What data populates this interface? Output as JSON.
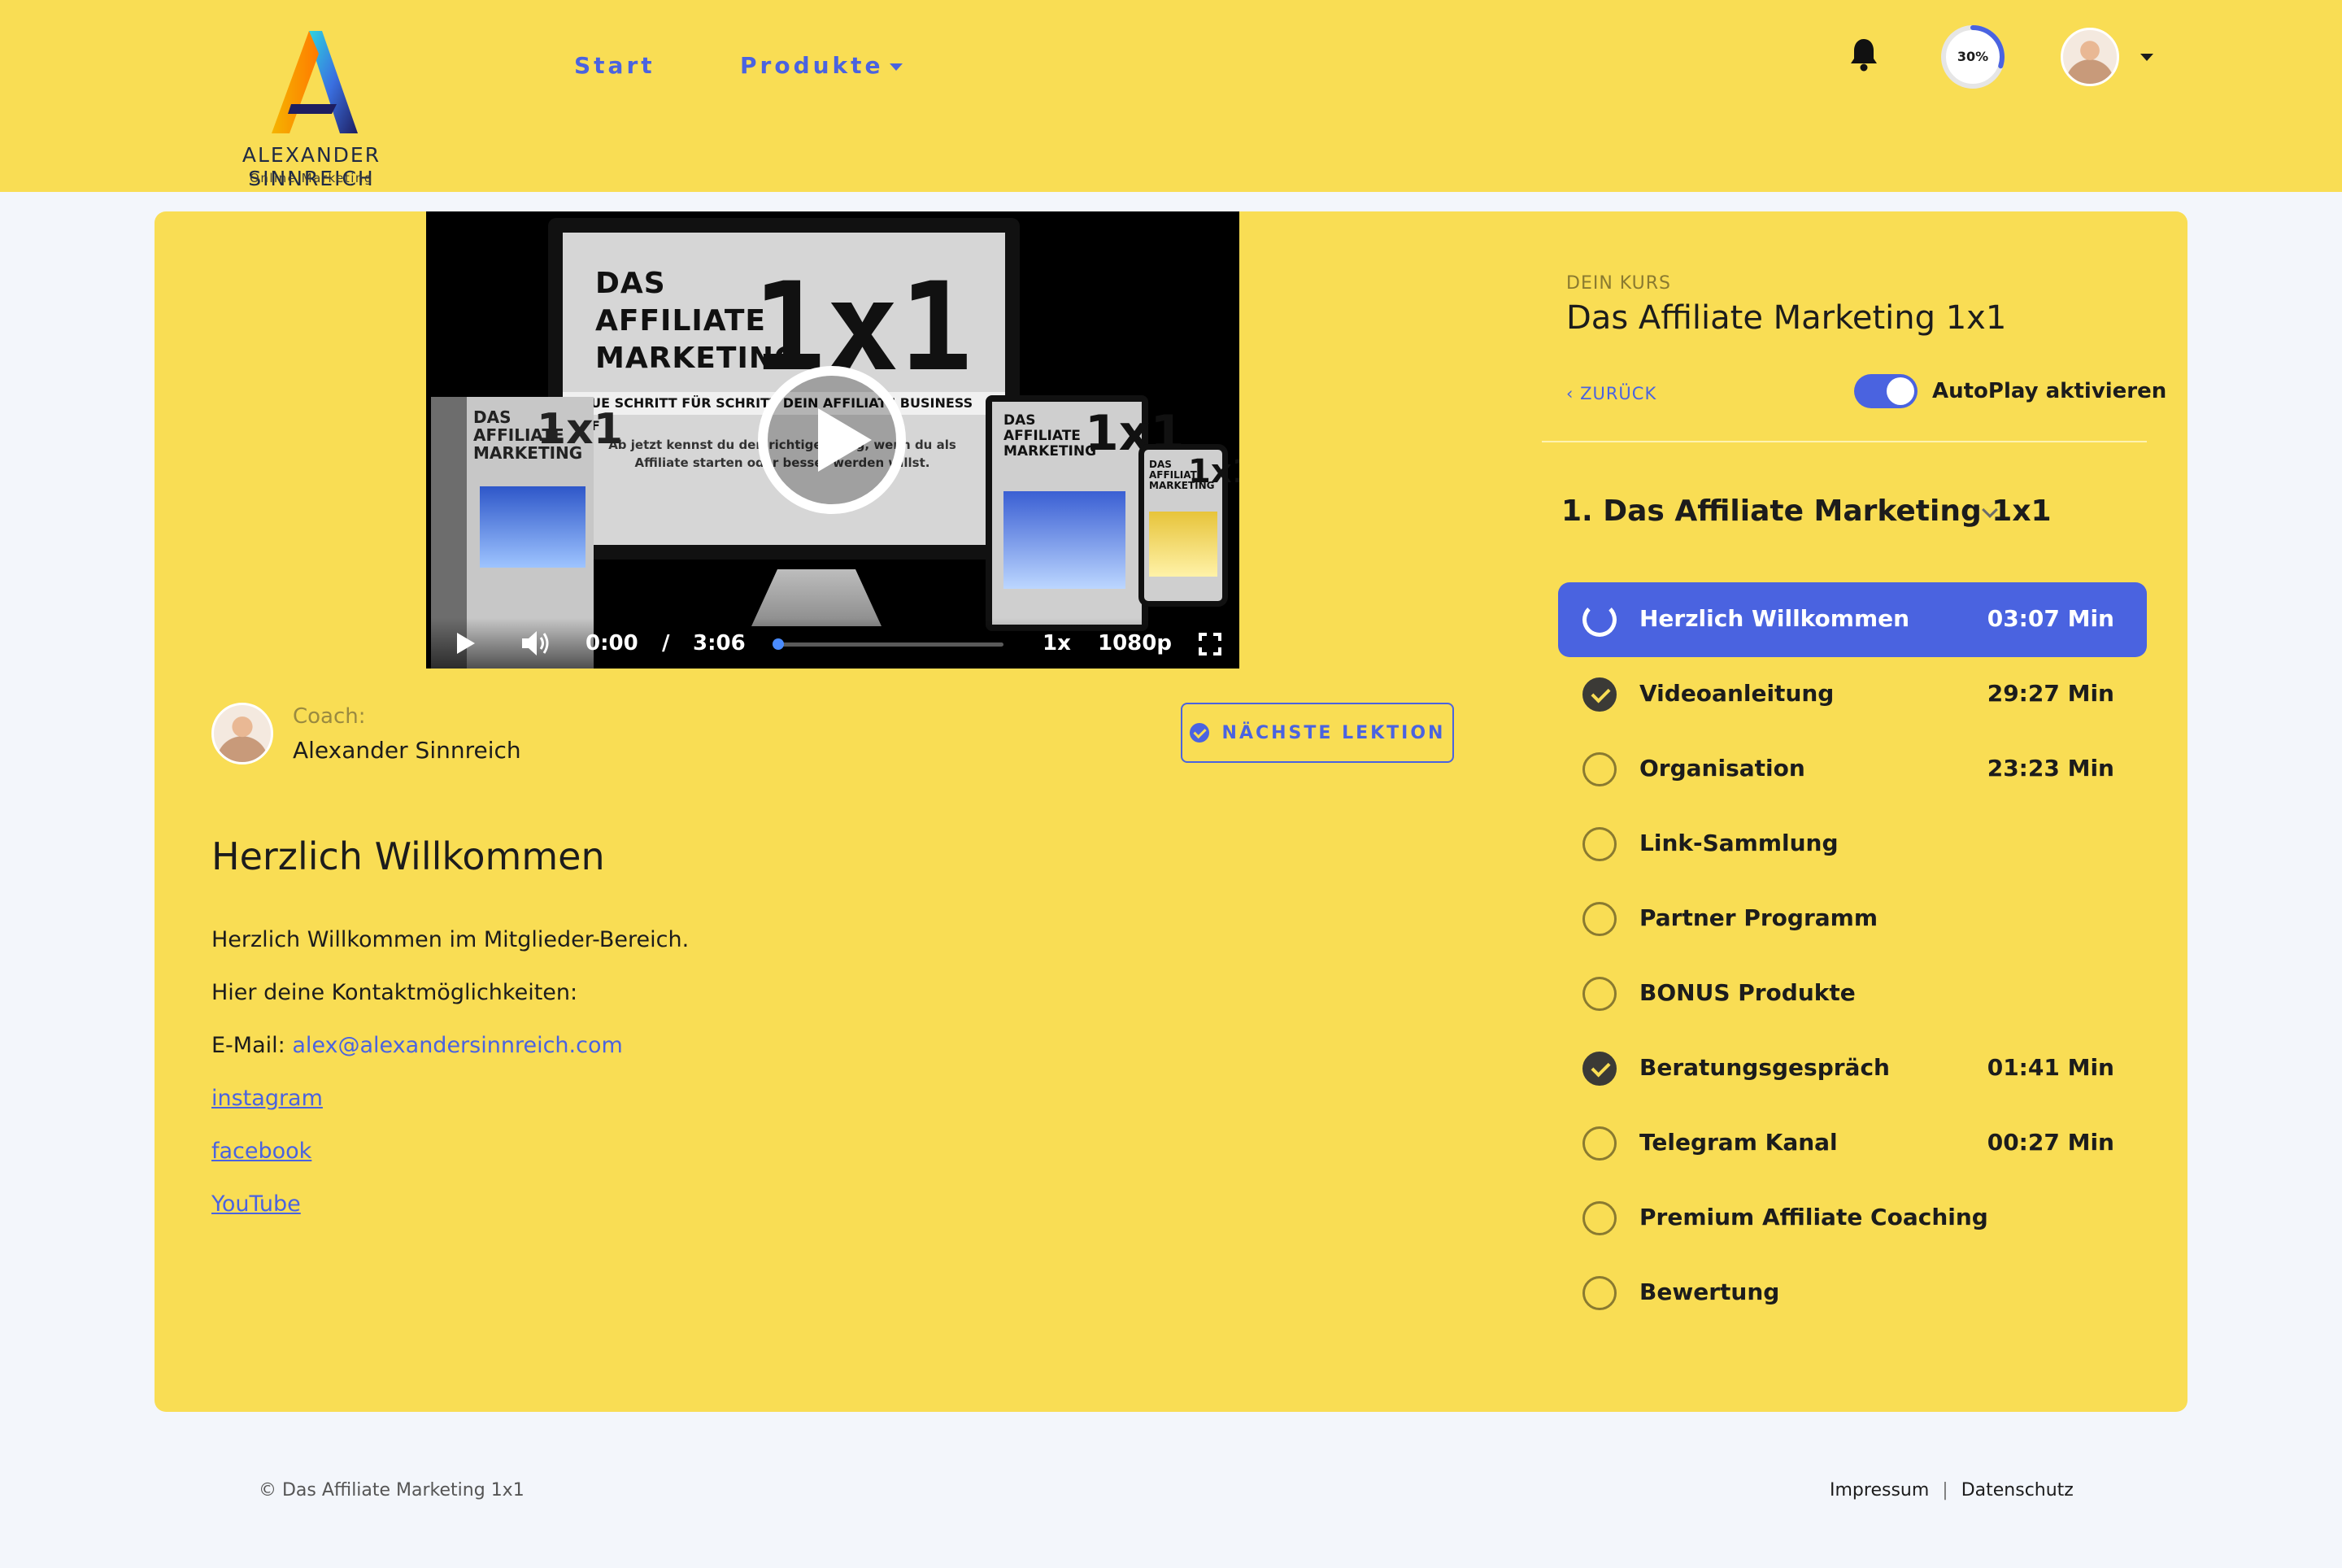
{
  "brand": {
    "logo_letter": "A",
    "name": "ALEXANDER SINNREICH",
    "tagline": "Online Marketing"
  },
  "nav": {
    "items": [
      {
        "label": "Start"
      },
      {
        "label": "Produkte"
      }
    ]
  },
  "header": {
    "progress_text": "30%",
    "progress_value": 0.3
  },
  "video": {
    "monitor_title": "DAS AFFILIATE MARKETING",
    "monitor_big": "1x1",
    "monitor_strip": "BAUE SCHRITT FÜR SCHRITT DEIN AFFILIATE BUSINESS AUF",
    "monitor_text": "Ab jetzt kennst du den richtigen Weg, wenn du als Affiliate starten oder besser werden willst.",
    "box_title": "DAS AFFILIATE MARKETING",
    "box_big": "1x1",
    "tablet_title": "DAS AFFILIATE MARKETING",
    "tablet_big": "1x1",
    "phone_title": "DAS AFFILIATE MARKETING",
    "phone_big": "1x1",
    "current_time": "0:00",
    "separator": "/",
    "duration": "3:06",
    "speed": "1x",
    "quality": "1080p"
  },
  "coach": {
    "label": "Coach:",
    "name": "Alexander Sinnreich"
  },
  "next_button": "NÄCHSTE LEKTION",
  "lesson": {
    "title": "Herzlich Willkommen",
    "line1": "Herzlich Willkommen im Mitglieder-Bereich.",
    "line2": "Hier deine Kontaktmöglichkeiten:",
    "email_label": "E-Mail: ",
    "email": "alex@alexandersinnreich.com",
    "links": [
      "instagram",
      "facebook",
      "YouTube"
    ]
  },
  "course": {
    "label": "DEIN KURS",
    "title": "Das Affiliate Marketing 1x1",
    "back": "ZURÜCK",
    "autoplay_label": "AutoPlay aktivieren",
    "module_title": "1. Das Affiliate Marketing 1x1",
    "lessons": [
      {
        "name": "Herzlich Willkommen",
        "duration": "03:07 Min",
        "state": "active"
      },
      {
        "name": "Videoanleitung",
        "duration": "29:27 Min",
        "state": "done"
      },
      {
        "name": "Organisation",
        "duration": "23:23 Min",
        "state": "open"
      },
      {
        "name": "Link-Sammlung",
        "duration": "",
        "state": "open"
      },
      {
        "name": "Partner Programm",
        "duration": "",
        "state": "open"
      },
      {
        "name": "BONUS Produkte",
        "duration": "",
        "state": "open"
      },
      {
        "name": "Beratungsgespräch",
        "duration": "01:41 Min",
        "state": "done"
      },
      {
        "name": "Telegram Kanal",
        "duration": "00:27 Min",
        "state": "open"
      },
      {
        "name": "Premium Affiliate Coaching",
        "duration": "",
        "state": "open"
      },
      {
        "name": "Bewertung",
        "duration": "",
        "state": "open"
      }
    ]
  },
  "footer": {
    "copyright": "© Das Affiliate Marketing 1x1",
    "impressum": "Impressum",
    "separator": "|",
    "datenschutz": "Datenschutz"
  },
  "colors": {
    "brand_yellow": "#f9dd54",
    "accent_blue": "#4a63e0",
    "page_bg": "#f3f6fb"
  },
  "icons": [
    "bell-icon",
    "chevron-down-icon",
    "play-icon",
    "volume-icon",
    "fullscreen-icon",
    "check-circle-icon",
    "chevron-left-icon",
    "spinner-icon"
  ]
}
